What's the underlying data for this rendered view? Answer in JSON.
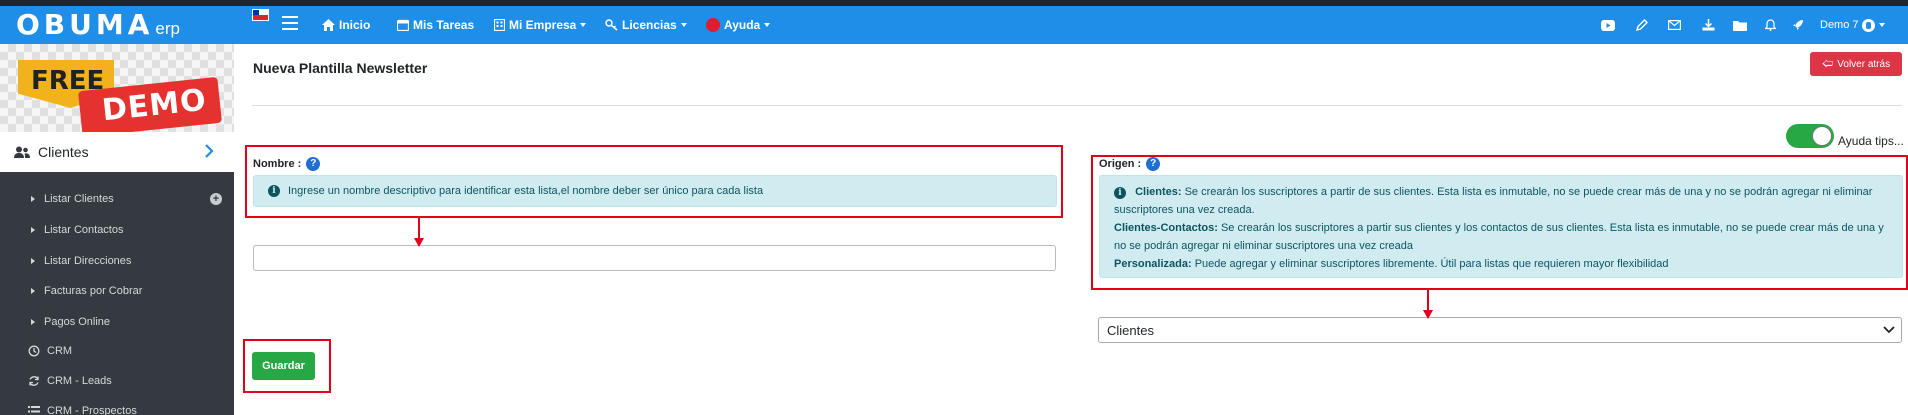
{
  "app": {
    "logo_text": "OBUMA",
    "logo_suffix": "erp"
  },
  "navbar": {
    "items": [
      {
        "label": "Inicio",
        "icon": "home-icon"
      },
      {
        "label": "Mis Tareas",
        "icon": "calendar-icon"
      },
      {
        "label": "Mi Empresa",
        "icon": "building-icon"
      },
      {
        "label": "Licencias",
        "icon": "key-icon"
      },
      {
        "label": "Ayuda",
        "icon": "help-circle-icon"
      }
    ],
    "right_icons": [
      "youtube-icon",
      "edit-icon",
      "mail-icon",
      "download-icon",
      "folder-icon",
      "bell-icon",
      "rocket-icon"
    ],
    "user_label": "Demo 7"
  },
  "sidebar": {
    "banner_free": "FREE",
    "banner_demo": "DEMO",
    "section": "Clientes",
    "items": [
      {
        "label": "Listar Clientes"
      },
      {
        "label": "Listar Contactos"
      },
      {
        "label": "Listar Direcciones"
      },
      {
        "label": "Facturas por Cobrar"
      },
      {
        "label": "Pagos Online"
      },
      {
        "label": "CRM"
      },
      {
        "label": "CRM - Leads"
      },
      {
        "label": "CRM - Prospectos"
      }
    ]
  },
  "page": {
    "title": "Nueva Plantilla Newsletter",
    "back_button": "Volver atrás",
    "tips_label": "Ayuda tips...",
    "tips_enabled": true
  },
  "form": {
    "nombre": {
      "label": "Nombre :",
      "help": "Ingrese un nombre descriptivo para identificar esta lista,el nombre deber ser único para cada lista",
      "value": ""
    },
    "origen": {
      "label": "Origen :",
      "help_items": [
        {
          "term": "Clientes:",
          "text": " Se crearán los suscriptores a partir de sus clientes. Esta lista es inmutable, no se puede crear más de una y no se podrán agregar ni eliminar suscriptores una vez creada."
        },
        {
          "term": "Clientes-Contactos:",
          "text": " Se crearán los suscriptores a partir sus clientes y los contactos de sus clientes. Esta lista es inmutable, no se puede crear más de una y no se podrán agregar ni eliminar suscriptores una vez creada"
        },
        {
          "term": "Personalizada:",
          "text": " Puede agregar y eliminar suscriptores libremente. Útil para listas que requieren mayor flexibilidad"
        }
      ],
      "selected": "Clientes"
    },
    "save_button": "Guardar"
  },
  "colors": {
    "navbar": "#1f8ee8",
    "sidebar": "#343a40",
    "info_bg": "#d1ecf1",
    "danger": "#dc3545",
    "success": "#28a745",
    "annotation": "#e3001b"
  }
}
